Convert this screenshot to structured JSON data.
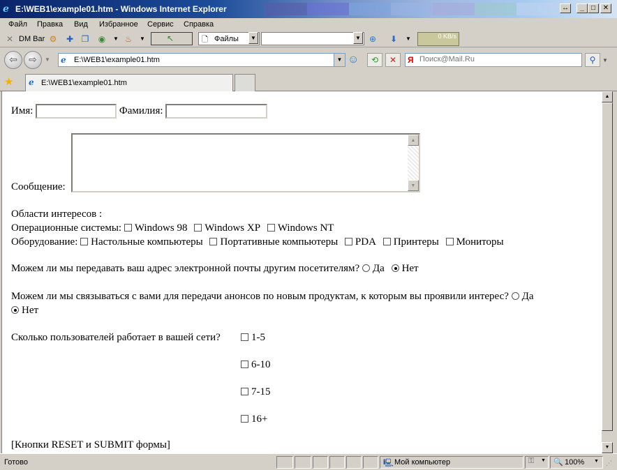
{
  "window": {
    "title": "E:\\WEB1\\example01.htm - Windows Internet Explorer",
    "controls": {
      "restore": "↔",
      "minimize": "_",
      "maximize": "□",
      "close": "✕"
    },
    "stripe_colors": [
      "#5a5aa8",
      "#6b6bd6",
      "#7ea6e0",
      "#9ab4e6",
      "#a8a8d8",
      "#9ccac8",
      "#c0d4ee"
    ]
  },
  "menu": {
    "file": "Файл",
    "edit": "Правка",
    "view": "Вид",
    "favorites": "Избранное",
    "tools": "Сервис",
    "help": "Справка"
  },
  "toolbar": {
    "dm_bar": "DM Bar",
    "files_label": "Файлы",
    "speed": "0 KB/s"
  },
  "address": {
    "url": "E:\\WEB1\\example01.htm",
    "search_placeholder": "Поиск@Mail.Ru"
  },
  "tab": {
    "label": "E:\\WEB1\\example01.htm"
  },
  "form": {
    "first_name_label": "Имя:",
    "last_name_label": "Фамилия:",
    "message_label": "Сообщение:",
    "interests_label": "Области интересов :",
    "os_label": "Операционные системы:",
    "os_options": [
      "Windows 98",
      "Windows XP",
      "Windows NT"
    ],
    "hardware_label": "Оборудование:",
    "hardware_options": [
      "Настольные компьютеры",
      "Портативные компьютеры",
      "PDA",
      "Принтеры",
      "Мониторы"
    ],
    "q_email": "Можем ли мы передавать ваш адрес электронной почты другим посетителям?",
    "q_contact": "Можем ли мы связываться с вами для передачи анонсов по новым продуктам, к которым вы проявили интерес?",
    "yes": "Да",
    "no": "Нет",
    "q_users": "Сколько пользователей работает в вашей сети?",
    "user_ranges": [
      "1-5",
      "6-10",
      "7-15",
      "16+"
    ],
    "footer": "[Кнопки RESET и SUBMIT формы]"
  },
  "status": {
    "text": "Готово",
    "zone": "Мой компьютер",
    "zoom": "100%"
  }
}
